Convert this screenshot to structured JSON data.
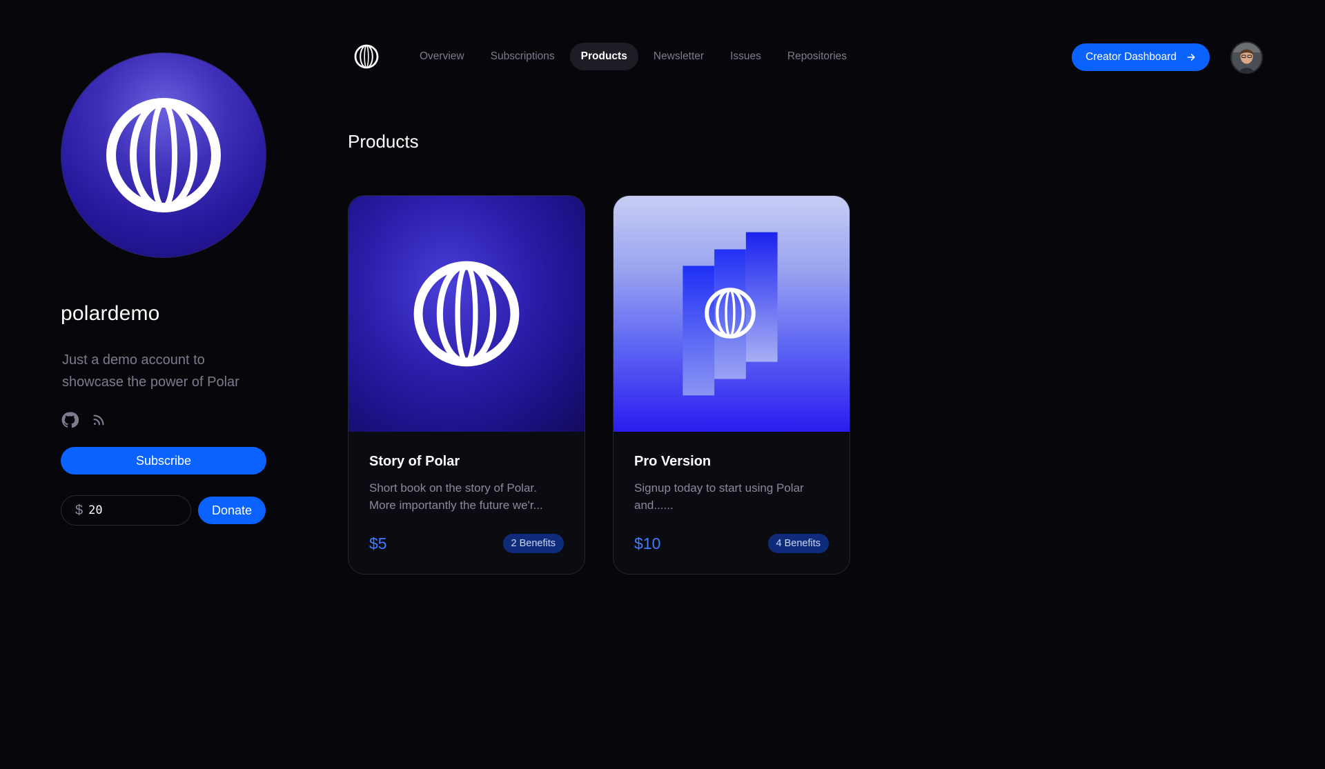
{
  "profile": {
    "name": "polardemo",
    "bio": "Just a demo account to showcase the power of Polar",
    "subscribe_label": "Subscribe",
    "donate": {
      "currency_symbol": "$",
      "amount": "20",
      "button_label": "Donate"
    },
    "social_icons": [
      "github-icon",
      "rss-icon"
    ]
  },
  "nav": {
    "tabs": [
      {
        "label": "Overview",
        "active": false
      },
      {
        "label": "Subscriptions",
        "active": false
      },
      {
        "label": "Products",
        "active": true
      },
      {
        "label": "Newsletter",
        "active": false
      },
      {
        "label": "Issues",
        "active": false
      },
      {
        "label": "Repositories",
        "active": false
      }
    ],
    "creator_dashboard_label": "Creator Dashboard"
  },
  "main": {
    "section_title": "Products",
    "products": [
      {
        "title": "Story of Polar",
        "description": "Short book on the story of Polar. More importantly the future we'r...",
        "price": "$5",
        "benefits": "2 Benefits"
      },
      {
        "title": "Pro Version",
        "description": "Signup today to start using Polar and......",
        "price": "$10",
        "benefits": "4 Benefits"
      }
    ]
  },
  "colors": {
    "accent": "#0a62ff",
    "background": "#07070b",
    "price": "#3d7bff",
    "badge_bg": "#0e2c7a"
  }
}
